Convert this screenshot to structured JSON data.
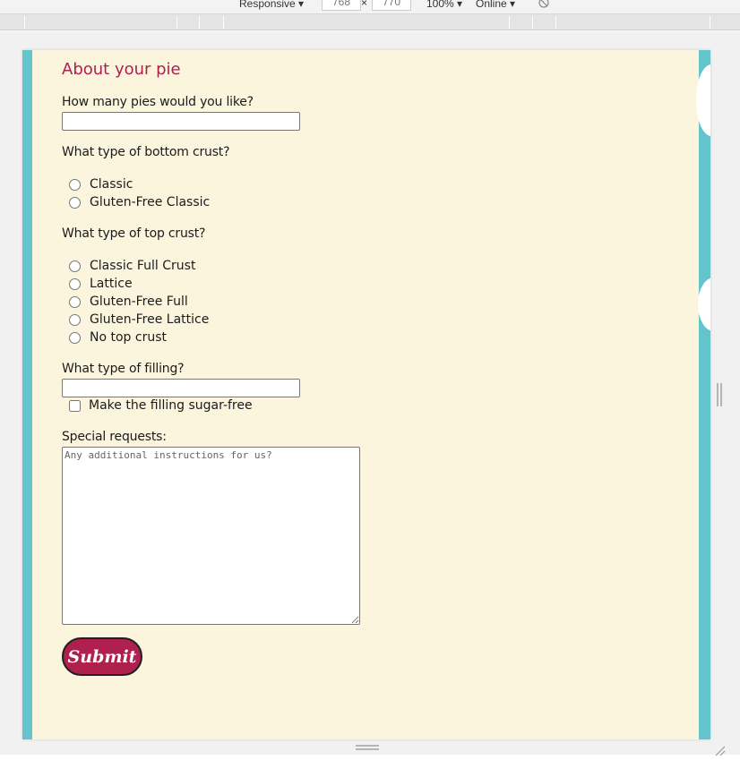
{
  "devtools": {
    "device": "Responsive ▾",
    "width": "768",
    "height": "770",
    "zoom": "100% ▾",
    "throttle": "Online ▾",
    "rotate_icon": "rotate-icon"
  },
  "form": {
    "heading": "About your pie",
    "quantity": {
      "label": "How many pies would you like?",
      "value": ""
    },
    "bottom_crust": {
      "label": "What type of bottom crust?",
      "options": [
        "Classic",
        "Gluten-Free Classic"
      ]
    },
    "top_crust": {
      "label": "What type of top crust?",
      "options": [
        "Classic Full Crust",
        "Lattice",
        "Gluten-Free Full",
        "Gluten-Free Lattice",
        "No top crust"
      ]
    },
    "filling": {
      "label": "What type of filling?",
      "value": "",
      "sugar_free_label": "Make the filling sugar-free",
      "sugar_free_checked": false
    },
    "special_requests": {
      "label": "Special requests:",
      "placeholder": "Any additional instructions for us?"
    },
    "submit_label": "Submit"
  },
  "colors": {
    "accent": "#b0204f",
    "band": "#63c4cb",
    "page_bg": "#fbf5de"
  }
}
